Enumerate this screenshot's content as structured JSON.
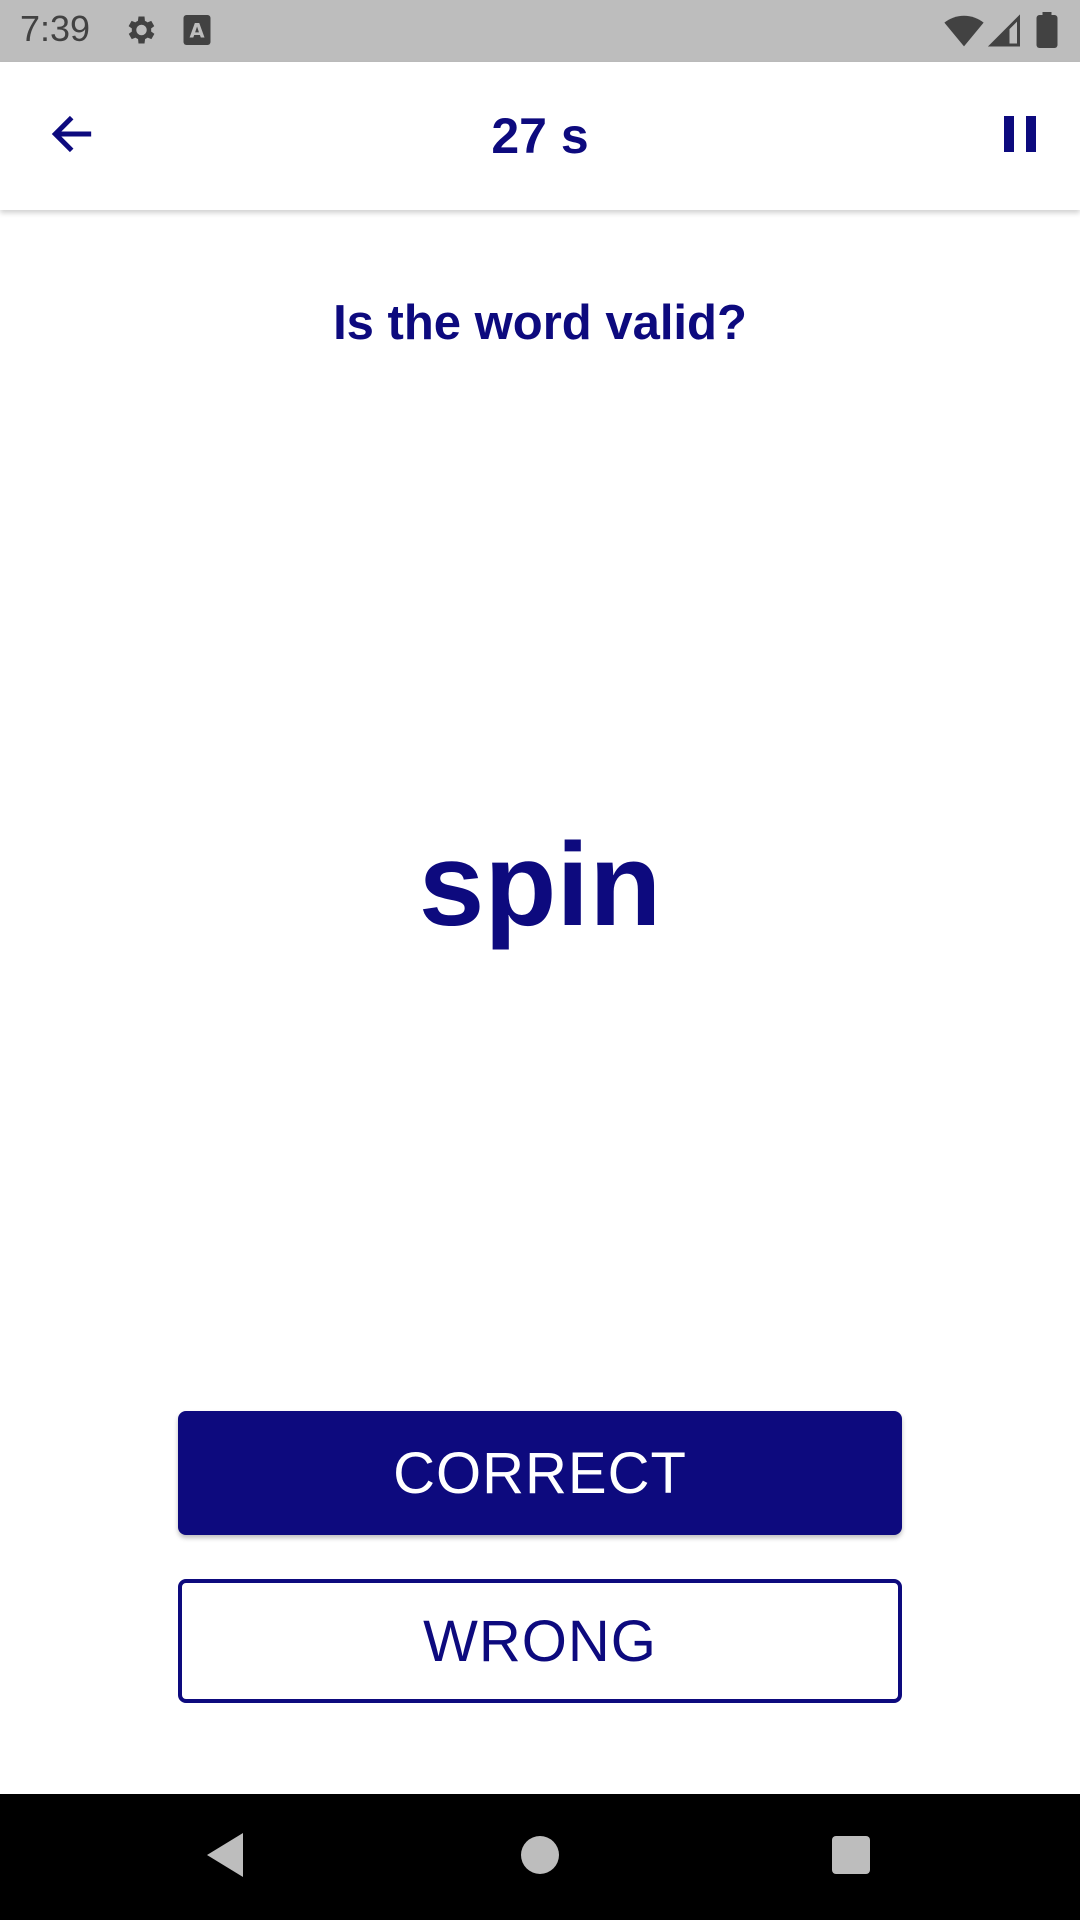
{
  "status_bar": {
    "time": "7:39",
    "icons": [
      "gear-icon",
      "keyboard-a-icon",
      "wifi-icon",
      "signal-icon",
      "battery-icon"
    ]
  },
  "app_bar": {
    "timer": "27 s",
    "back_icon": "arrow-back-icon",
    "pause_icon": "pause-icon"
  },
  "quiz": {
    "question": "Is the word valid?",
    "word": "spin"
  },
  "buttons": {
    "correct_label": "CORRECT",
    "wrong_label": "WRONG"
  },
  "nav_bar": {
    "icons": [
      "back-triangle-icon",
      "home-circle-icon",
      "recents-square-icon"
    ]
  },
  "colors": {
    "accent": "#0d0a7e",
    "status_bar_bg": "#bdbdbd",
    "nav_bar_bg": "#000000"
  }
}
